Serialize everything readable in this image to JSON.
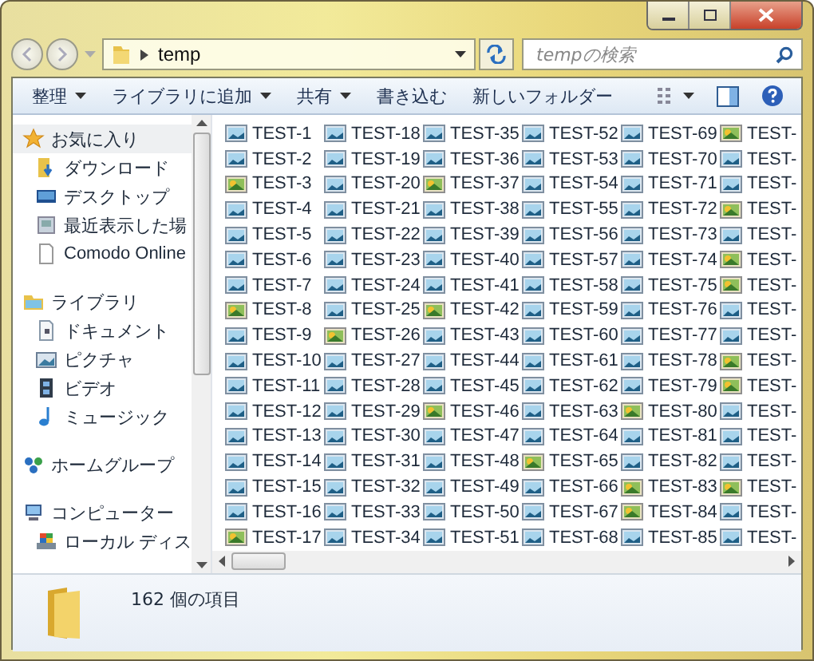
{
  "address": {
    "path": "temp"
  },
  "search": {
    "placeholder": "tempの検索"
  },
  "toolbar": [
    {
      "label": "整理",
      "dropdown": true
    },
    {
      "label": "ライブラリに追加",
      "dropdown": true
    },
    {
      "label": "共有",
      "dropdown": true
    },
    {
      "label": "書き込む",
      "dropdown": false
    },
    {
      "label": "新しいフォルダー",
      "dropdown": false
    }
  ],
  "nav": [
    {
      "label": "お気に入り",
      "kind": "star",
      "selected": true,
      "children": [
        {
          "label": "ダウンロード",
          "kind": "download",
          "selected": false
        },
        {
          "label": "デスクトップ",
          "kind": "desktop",
          "selected": false
        },
        {
          "label": "最近表示した場",
          "kind": "recent",
          "selected": false
        },
        {
          "label": "Comodo Online",
          "kind": "file",
          "selected": false
        }
      ]
    },
    {
      "label": "ライブラリ",
      "kind": "library",
      "selected": false,
      "children": [
        {
          "label": "ドキュメント",
          "kind": "document",
          "selected": false
        },
        {
          "label": "ピクチャ",
          "kind": "picture",
          "selected": false
        },
        {
          "label": "ビデオ",
          "kind": "video",
          "selected": false
        },
        {
          "label": "ミュージック",
          "kind": "music",
          "selected": false
        }
      ]
    },
    {
      "label": "ホームグループ",
      "kind": "homegroup",
      "selected": false
    },
    {
      "label": "コンピューター",
      "kind": "computer",
      "selected": false,
      "children": [
        {
          "label": "ローカル ディス",
          "kind": "disk",
          "selected": false
        }
      ]
    }
  ],
  "files": [
    {
      "name": "TEST-1",
      "kind": "image"
    },
    {
      "name": "TEST-2",
      "kind": "image"
    },
    {
      "name": "TEST-3",
      "kind": "photo"
    },
    {
      "name": "TEST-4",
      "kind": "image"
    },
    {
      "name": "TEST-5",
      "kind": "image"
    },
    {
      "name": "TEST-6",
      "kind": "image"
    },
    {
      "name": "TEST-7",
      "kind": "image"
    },
    {
      "name": "TEST-8",
      "kind": "photo"
    },
    {
      "name": "TEST-9",
      "kind": "image"
    },
    {
      "name": "TEST-10",
      "kind": "image"
    },
    {
      "name": "TEST-11",
      "kind": "image"
    },
    {
      "name": "TEST-12",
      "kind": "image"
    },
    {
      "name": "TEST-13",
      "kind": "image"
    },
    {
      "name": "TEST-14",
      "kind": "image"
    },
    {
      "name": "TEST-15",
      "kind": "image"
    },
    {
      "name": "TEST-16",
      "kind": "image"
    },
    {
      "name": "TEST-17",
      "kind": "photo"
    },
    {
      "name": "TEST-18",
      "kind": "image"
    },
    {
      "name": "TEST-19",
      "kind": "image"
    },
    {
      "name": "TEST-20",
      "kind": "image"
    },
    {
      "name": "TEST-21",
      "kind": "image"
    },
    {
      "name": "TEST-22",
      "kind": "image"
    },
    {
      "name": "TEST-23",
      "kind": "image"
    },
    {
      "name": "TEST-24",
      "kind": "image"
    },
    {
      "name": "TEST-25",
      "kind": "image"
    },
    {
      "name": "TEST-26",
      "kind": "photo"
    },
    {
      "name": "TEST-27",
      "kind": "image"
    },
    {
      "name": "TEST-28",
      "kind": "image"
    },
    {
      "name": "TEST-29",
      "kind": "image"
    },
    {
      "name": "TEST-30",
      "kind": "image"
    },
    {
      "name": "TEST-31",
      "kind": "image"
    },
    {
      "name": "TEST-32",
      "kind": "image"
    },
    {
      "name": "TEST-33",
      "kind": "image"
    },
    {
      "name": "TEST-34",
      "kind": "image"
    },
    {
      "name": "TEST-35",
      "kind": "image"
    },
    {
      "name": "TEST-36",
      "kind": "image"
    },
    {
      "name": "TEST-37",
      "kind": "photo"
    },
    {
      "name": "TEST-38",
      "kind": "image"
    },
    {
      "name": "TEST-39",
      "kind": "image"
    },
    {
      "name": "TEST-40",
      "kind": "image"
    },
    {
      "name": "TEST-41",
      "kind": "image"
    },
    {
      "name": "TEST-42",
      "kind": "photo"
    },
    {
      "name": "TEST-43",
      "kind": "image"
    },
    {
      "name": "TEST-44",
      "kind": "image"
    },
    {
      "name": "TEST-45",
      "kind": "image"
    },
    {
      "name": "TEST-46",
      "kind": "photo"
    },
    {
      "name": "TEST-47",
      "kind": "image"
    },
    {
      "name": "TEST-48",
      "kind": "image"
    },
    {
      "name": "TEST-49",
      "kind": "image"
    },
    {
      "name": "TEST-50",
      "kind": "image"
    },
    {
      "name": "TEST-51",
      "kind": "image"
    },
    {
      "name": "TEST-52",
      "kind": "image"
    },
    {
      "name": "TEST-53",
      "kind": "image"
    },
    {
      "name": "TEST-54",
      "kind": "image"
    },
    {
      "name": "TEST-55",
      "kind": "image"
    },
    {
      "name": "TEST-56",
      "kind": "image"
    },
    {
      "name": "TEST-57",
      "kind": "image"
    },
    {
      "name": "TEST-58",
      "kind": "image"
    },
    {
      "name": "TEST-59",
      "kind": "image"
    },
    {
      "name": "TEST-60",
      "kind": "image"
    },
    {
      "name": "TEST-61",
      "kind": "image"
    },
    {
      "name": "TEST-62",
      "kind": "image"
    },
    {
      "name": "TEST-63",
      "kind": "image"
    },
    {
      "name": "TEST-64",
      "kind": "image"
    },
    {
      "name": "TEST-65",
      "kind": "photo"
    },
    {
      "name": "TEST-66",
      "kind": "image"
    },
    {
      "name": "TEST-67",
      "kind": "image"
    },
    {
      "name": "TEST-68",
      "kind": "image"
    },
    {
      "name": "TEST-69",
      "kind": "image"
    },
    {
      "name": "TEST-70",
      "kind": "image"
    },
    {
      "name": "TEST-71",
      "kind": "image"
    },
    {
      "name": "TEST-72",
      "kind": "image"
    },
    {
      "name": "TEST-73",
      "kind": "image"
    },
    {
      "name": "TEST-74",
      "kind": "image"
    },
    {
      "name": "TEST-75",
      "kind": "image"
    },
    {
      "name": "TEST-76",
      "kind": "image"
    },
    {
      "name": "TEST-77",
      "kind": "image"
    },
    {
      "name": "TEST-78",
      "kind": "image"
    },
    {
      "name": "TEST-79",
      "kind": "image"
    },
    {
      "name": "TEST-80",
      "kind": "photo"
    },
    {
      "name": "TEST-81",
      "kind": "image"
    },
    {
      "name": "TEST-82",
      "kind": "image"
    },
    {
      "name": "TEST-83",
      "kind": "photo"
    },
    {
      "name": "TEST-84",
      "kind": "photo"
    },
    {
      "name": "TEST-85",
      "kind": "image"
    },
    {
      "name": "TEST-",
      "kind": "photo"
    },
    {
      "name": "TEST-",
      "kind": "image"
    },
    {
      "name": "TEST-",
      "kind": "image"
    },
    {
      "name": "TEST-",
      "kind": "photo"
    },
    {
      "name": "TEST-",
      "kind": "image"
    },
    {
      "name": "TEST-",
      "kind": "photo"
    },
    {
      "name": "TEST-",
      "kind": "photo"
    },
    {
      "name": "TEST-",
      "kind": "image"
    },
    {
      "name": "TEST-",
      "kind": "image"
    },
    {
      "name": "TEST-",
      "kind": "photo"
    },
    {
      "name": "TEST-",
      "kind": "photo"
    },
    {
      "name": "TEST-",
      "kind": "image"
    },
    {
      "name": "TEST-",
      "kind": "image"
    },
    {
      "name": "TEST-",
      "kind": "image"
    },
    {
      "name": "TEST-",
      "kind": "photo"
    },
    {
      "name": "TEST-",
      "kind": "image"
    },
    {
      "name": "TEST-",
      "kind": "image"
    }
  ],
  "status": {
    "count": "162 個の項目"
  }
}
